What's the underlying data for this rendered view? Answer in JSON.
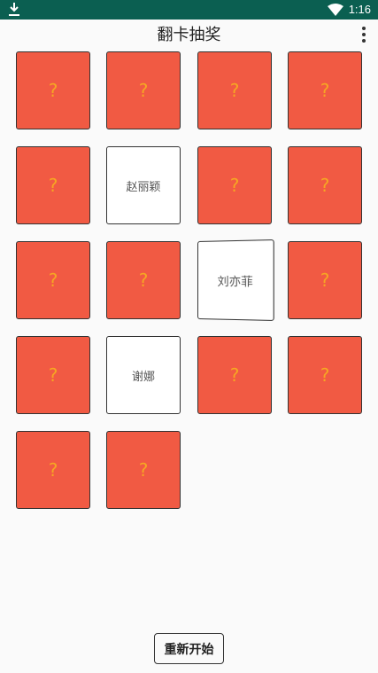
{
  "status_bar": {
    "time": "1:16",
    "icons": [
      "download-icon",
      "wifi-icon"
    ]
  },
  "app_bar": {
    "title": "翻卡抽奖",
    "menu_icon": "more-vert-icon"
  },
  "cards": [
    {
      "state": "back",
      "text": "?"
    },
    {
      "state": "back",
      "text": "?"
    },
    {
      "state": "back",
      "text": "?"
    },
    {
      "state": "back",
      "text": "?"
    },
    {
      "state": "back",
      "text": "?"
    },
    {
      "state": "front",
      "text": "赵丽颖"
    },
    {
      "state": "back",
      "text": "?"
    },
    {
      "state": "back",
      "text": "?"
    },
    {
      "state": "back",
      "text": "?"
    },
    {
      "state": "back",
      "text": "?"
    },
    {
      "state": "front",
      "text": "刘亦菲"
    },
    {
      "state": "back",
      "text": "?"
    },
    {
      "state": "back",
      "text": "?"
    },
    {
      "state": "front",
      "text": "谢娜"
    },
    {
      "state": "back",
      "text": "?"
    },
    {
      "state": "back",
      "text": "?"
    },
    {
      "state": "back",
      "text": "?"
    },
    {
      "state": "back",
      "text": "?"
    }
  ],
  "restart_label": "重新开始",
  "colors": {
    "card_back": "#f15a43",
    "question_mark": "#f6a623",
    "status_bar": "#0b5f51"
  }
}
